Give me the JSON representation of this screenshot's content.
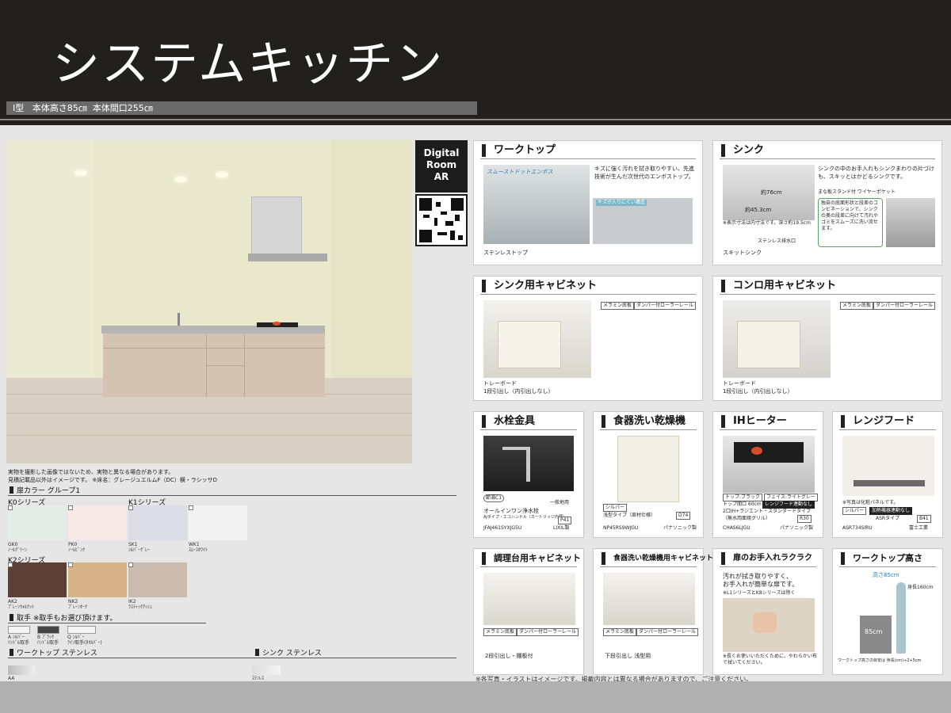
{
  "header": {
    "title": "システムキッチン",
    "spec": "I型   本体高さ85㎝  本体間口255㎝"
  },
  "ar": {
    "badge_line1": "Digital",
    "badge_line2": "Room",
    "badge_line3": "AR"
  },
  "render_caption": {
    "line1": "実物を撮影した画像ではないため、実物と異なる場合があります。",
    "line2": "見積記載品以外はイメージです。  ※床名：グレージュエルムF（DC）横・ラシッサD"
  },
  "door_color": {
    "heading": "扉カラー  グループ1",
    "series": [
      {
        "label": "K0シリーズ"
      },
      {
        "label": "K1シリーズ"
      },
      {
        "label": "K2シリーズ"
      }
    ],
    "swatches": [
      {
        "code": "GK0",
        "name": "ﾉｰﾙｸﾞﾘｰﾝ",
        "color": "#e4ece7"
      },
      {
        "code": "PK0",
        "name": "ﾉｰﾙﾋﾟﾝｸ",
        "color": "#f8e9e6"
      },
      {
        "code": "SK1",
        "name": "ｼﾙﾊﾞｰｸﾞﾚｰ",
        "color": "#dcdce6"
      },
      {
        "code": "WK1",
        "name": "ｽﾑｰｽﾎﾜｲﾄ",
        "color": "#f2f2f2"
      },
      {
        "code": "AK2",
        "name": "ﾌﾟﾚｰﾝｳｫﾙﾅｯﾄ",
        "color": "#5c4035"
      },
      {
        "code": "NK2",
        "name": "ﾌﾟﾚｰﾝｵｰｸ",
        "color": "#d6b487"
      },
      {
        "code": "IK2",
        "name": "ﾗｽﾃｨｯｸｱｯｼｭ",
        "color": "#cbbbae"
      }
    ]
  },
  "handle": {
    "heading": "取手  ※取手もお選び頂けます。",
    "items": [
      {
        "line1": "A ｼﾙﾊﾞｰ",
        "line2": "ﾊﾝﾄﾞﾙ取手"
      },
      {
        "line1": "B ﾌﾞﾗｯｸ",
        "line2": "ﾊﾝﾄﾞﾙ取手"
      },
      {
        "line1": "Q ｼﾙﾊﾞｰ",
        "line2": "ﾗｲﾝ取手(ﾀｵﾙﾊﾞｰ)"
      }
    ]
  },
  "worktop_section": {
    "heading": "ワークトップ   ステンレス",
    "code": "AA"
  },
  "sink_section": {
    "heading": "シンク   ステンレス",
    "code": "ｽﾃﾝﾚｽ"
  },
  "cards": {
    "worktop": {
      "title": "ワークトップ",
      "desc": "キズに強く汚れを拭き取りやすい、先進技術が生んだ次世代のエンボストップ。",
      "brand": "スムーストドットエンボス",
      "badge": "キズが入りにくい構造",
      "caption": "ステンレストップ"
    },
    "sink": {
      "title": "シンク",
      "desc": "シンクの中のお手入れもシンクまわりの片づけも、スキッとはかどるシンクです。",
      "dims1": "約76cm",
      "dims2": "約45.3cm",
      "note1": "※表示寸法は内寸法です。深さ約19.5cm",
      "note2": "まな板スタンド付 ワイヤーポケット",
      "desc2": "独自の底面形状と段差のコンビネーションで、シンクの奥の段差に向けて汚れやゴミをスムーズに洗い流せます。",
      "drain": "ステンレス排水口",
      "caption": "スキットシンク"
    },
    "sink_cabinet": {
      "title": "シンク用キャビネット",
      "tag1": "メラミン底板",
      "tag2": "ダンパー付ローラーレール",
      "caption1": "トレーボード",
      "caption2": "1段引出し（内引出しなし）"
    },
    "stove_cabinet": {
      "title": "コンロ用キャビネット",
      "tag1": "メラミン底板",
      "tag2": "ダンパー付ローラーレール",
      "caption1": "トレーボード",
      "caption2": "1段引出し（内引出しなし）"
    },
    "faucet": {
      "title": "水栓金具",
      "badge": "節湯C1",
      "note": "一般地用",
      "desc1": "オールインワン浄水栓",
      "desc2": "AJタイプ・エコハンドル（カートリッジ内蔵）",
      "size": "P41",
      "model": "JFAJ461SYXJG5U",
      "maker": "LIXIL製"
    },
    "dishwasher": {
      "title": "食器洗い乾燥機",
      "tag": "シルバー",
      "desc": "浅型タイプ（扉材仕様）",
      "size": "D74",
      "model": "NP45RS9WJGU",
      "maker": "パナソニック製"
    },
    "ih": {
      "title": "IHヒーター",
      "tag1": "トップ:ブラック",
      "tag2": "フェイス:ライトグレー",
      "line1": "トップ間口 60cm",
      "tag3": "レンジフード連動なし",
      "line2": "2口IH+ラジエント・スタンダードタイプ",
      "line3": "（無水両面焼グリル）",
      "size": "R30",
      "model": "CHAS6LJGU",
      "maker": "パナソニック製"
    },
    "range_hood": {
      "title": "レンジフード",
      "note": "※写真は化粧パネルです。",
      "tag1": "シルバー",
      "tag2": "加熱機器連動なし",
      "line": "ASRタイプ",
      "size": "B41",
      "model": "ASR734SIRU",
      "maker": "富士工業"
    },
    "stove_prep_cabinet": {
      "title": "調理台用キャビネット",
      "tag1": "メラミン底板",
      "tag2": "ダンパー付ローラーレール",
      "caption": "2段引出し・棚板付"
    },
    "dishwasher_cabinet": {
      "title": "食器洗い乾燥機用キャビネット",
      "tag1": "メラミン底板",
      "tag2": "ダンパー付ローラーレール",
      "caption": "下段引出し 浅型用"
    },
    "door_care": {
      "title": "扉のお手入れラクラク",
      "desc1": "汚れが拭き取りやすく、",
      "desc2": "お手入れが簡単な扉です。",
      "note": "※L1シリーズとK8シリーズは除く",
      "caption": "※長くお使いいただくために、やわらかい布で拭いてください。"
    },
    "worktop_height": {
      "title": "ワークトップ高さ",
      "height_label": "高さ85cm",
      "person": "身長160cm",
      "box": "85cm",
      "formula": "ワークトップ高さの目安は 身長(cm)÷2+5cm"
    }
  },
  "footnote": "※各写真・イラストはイメージです。掲載内容とは異なる場合がありますので、ご注意ください。"
}
